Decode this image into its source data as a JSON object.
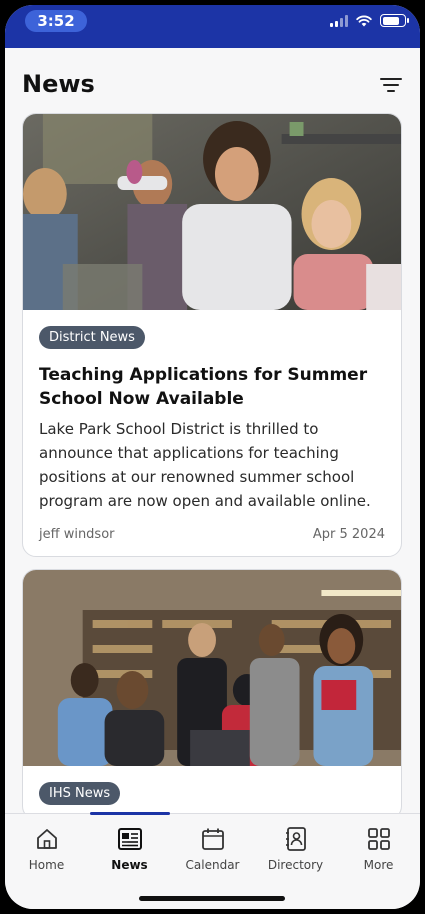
{
  "status": {
    "time": "3:52",
    "battery_level": 0.8
  },
  "header": {
    "title": "News"
  },
  "articles": [
    {
      "tag": "District News",
      "title": "Teaching Applications for Summer School Now Available",
      "description": "Lake Park School District is thrilled to announce that applications for teaching positions at our renowned summer school program are now open and available online.",
      "author": "jeff windsor",
      "date": "Apr 5 2024",
      "image_icon": "science-classroom-photo"
    },
    {
      "tag": "IHS News",
      "title": "",
      "description": "",
      "author": "",
      "date": "",
      "image_icon": "students-celebrating-photo"
    }
  ],
  "tabs": [
    {
      "label": "Home",
      "icon": "home-icon",
      "active": false
    },
    {
      "label": "News",
      "icon": "news-icon",
      "active": true
    },
    {
      "label": "Calendar",
      "icon": "calendar-icon",
      "active": false
    },
    {
      "label": "Directory",
      "icon": "directory-icon",
      "active": false
    },
    {
      "label": "More",
      "icon": "grid-icon",
      "active": false
    }
  ],
  "colors": {
    "brand": "#1c34a6",
    "tag_bg": "#4c5869"
  }
}
